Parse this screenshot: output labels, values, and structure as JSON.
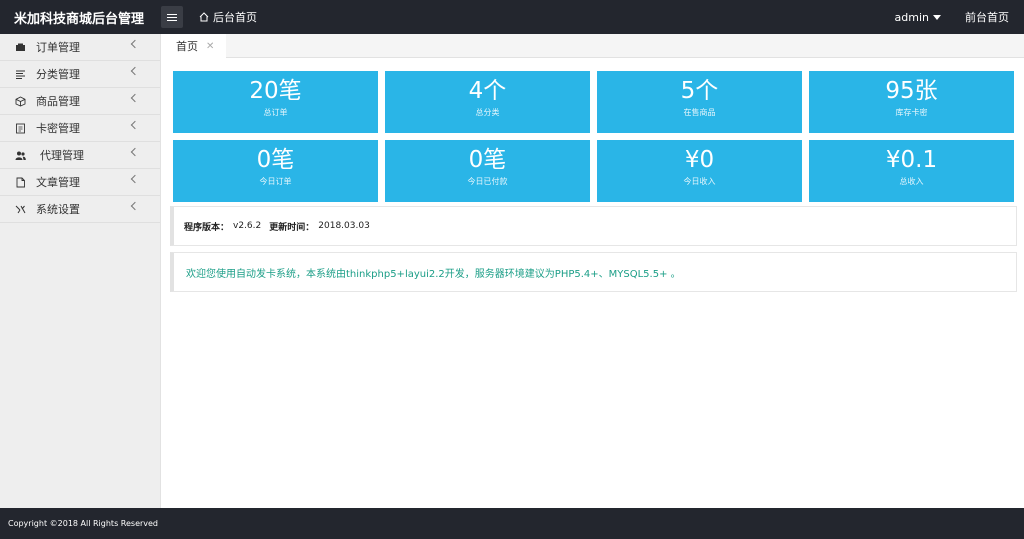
{
  "header": {
    "brand": "米加科技商城后台管理",
    "home_label": "后台首页",
    "user": "admin",
    "front_label": "前台首页"
  },
  "sidebar": {
    "items": [
      {
        "label": "订单管理",
        "icon": "order-icon"
      },
      {
        "label": "分类管理",
        "icon": "list-icon"
      },
      {
        "label": "商品管理",
        "icon": "cube-icon"
      },
      {
        "label": "卡密管理",
        "icon": "card-icon"
      },
      {
        "label": "代理管理",
        "icon": "users-icon"
      },
      {
        "label": "文章管理",
        "icon": "document-icon"
      },
      {
        "label": "系统设置",
        "icon": "settings-icon"
      }
    ]
  },
  "tabs": [
    {
      "label": "首页",
      "close": "✕"
    }
  ],
  "stats": [
    {
      "value": "20笔",
      "label": "总订单"
    },
    {
      "value": "4个",
      "label": "总分类"
    },
    {
      "value": "5个",
      "label": "在售商品"
    },
    {
      "value": "95张",
      "label": "库存卡密"
    },
    {
      "value": "0笔",
      "label": "今日订单"
    },
    {
      "value": "0笔",
      "label": "今日已付款"
    },
    {
      "value": "¥0",
      "label": "今日收入"
    },
    {
      "value": "¥0.1",
      "label": "总收入"
    }
  ],
  "info": {
    "version_label": "程序版本：",
    "version": "v2.6.2",
    "updated_label": "更新时间：",
    "updated": "2018.03.03",
    "welcome": "欢迎您使用自动发卡系统，本系统由thinkphp5+layui2.2开发，服务器环境建议为PHP5.4+、MYSQL5.5+ 。"
  },
  "footer": {
    "text": "Copyright ©2018 All Rights Reserved"
  },
  "colors": {
    "header": "#23262e",
    "card": "#2ab5e7",
    "welcome_text": "#1b9e87",
    "sidebar": "#eeeeee"
  }
}
